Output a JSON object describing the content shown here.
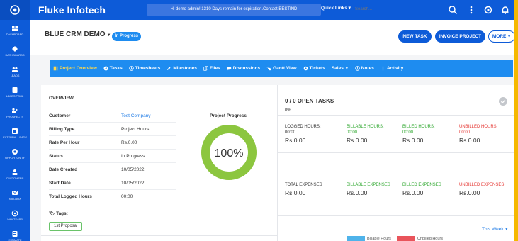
{
  "topbar": {
    "brand": "Fluke Infotech",
    "notice": "Hi demo admin! 1310 Days remain for expiration.Contact BESTIND",
    "quick_links": "Quick Links",
    "search_placeholder": "Search..."
  },
  "sidebar": {
    "items": [
      {
        "label": "DASHBOARD",
        "icon": "dashboard-icon"
      },
      {
        "label": "DASHBOARDS",
        "icon": "dashboards-icon"
      },
      {
        "label": "LEADS",
        "icon": "leads-icon"
      },
      {
        "label": "LEADS POOL",
        "icon": "leads-pool-icon"
      },
      {
        "label": "PROSPECTS",
        "icon": "prospects-icon"
      },
      {
        "label": "EXTERNAL LEADS",
        "icon": "external-leads-icon"
      },
      {
        "label": "OPPORTUNITY",
        "icon": "opportunity-icon"
      },
      {
        "label": "CUSTOMERS",
        "icon": "customers-icon"
      },
      {
        "label": "MAILBOX",
        "icon": "mailbox-icon"
      },
      {
        "label": "WHATSAPP",
        "icon": "whatsapp-icon"
      },
      {
        "label": "ESTIMATE",
        "icon": "estimate-icon"
      }
    ]
  },
  "project": {
    "title": "BLUE CRM DEMO",
    "status": "In Progress",
    "buttons": {
      "new_task": "NEW TASK",
      "invoice": "INVOICE PROJECT",
      "more": "MORE"
    }
  },
  "tabs": [
    {
      "label": "Project Overview",
      "icon": "bars-icon"
    },
    {
      "label": "Tasks",
      "icon": "check-circle-icon"
    },
    {
      "label": "Timesheets",
      "icon": "clock-icon"
    },
    {
      "label": "Milestones",
      "icon": "rocket-icon"
    },
    {
      "label": "Files",
      "icon": "files-icon"
    },
    {
      "label": "Discussions",
      "icon": "comments-icon"
    },
    {
      "label": "Gantt View",
      "icon": "gantt-icon"
    },
    {
      "label": "Tickets",
      "icon": "ticket-icon"
    },
    {
      "label": "Sales",
      "icon": ""
    },
    {
      "label": "Notes",
      "icon": "notes-icon"
    },
    {
      "label": "Activity",
      "icon": "activity-icon"
    }
  ],
  "overview": {
    "title": "OVERVIEW",
    "rows": [
      {
        "key": "Customer",
        "value": "Test Company"
      },
      {
        "key": "Billing Type",
        "value": "Project Hours"
      },
      {
        "key": "Rate Per Hour",
        "value": "Rs.0.00"
      },
      {
        "key": "Status",
        "value": "In Progress"
      },
      {
        "key": "Date Created",
        "value": "10/05/2022"
      },
      {
        "key": "Start Date",
        "value": "10/05/2022"
      },
      {
        "key": "Total Logged Hours",
        "value": "00:00"
      }
    ],
    "progress_title": "Project Progress",
    "progress_value": "100%",
    "progress_fraction": 1.0,
    "tags_label": "Tags:",
    "tag": "1st Proposal"
  },
  "tasks": {
    "title": "0 / 0 OPEN TASKS",
    "percent": "0%"
  },
  "hours": [
    {
      "label": "LOGGED HOURS:",
      "time": "00:00",
      "value": "Rs.0.00",
      "color": "#333333"
    },
    {
      "label": "BILLABLE HOURS:",
      "time": "00:00",
      "value": "Rs.0.00",
      "color": "#2aa52a"
    },
    {
      "label": "BILLED HOURS:",
      "time": "00:00",
      "value": "Rs.0.00",
      "color": "#2aa52a"
    },
    {
      "label": "UNBILLED HOURS:",
      "time": "00:00",
      "value": "Rs.0.00",
      "color": "#e53935"
    }
  ],
  "expenses": [
    {
      "label": "TOTAL EXPENSES",
      "value": "Rs.0.00",
      "color": "#333333"
    },
    {
      "label": "BILLABLE EXPENSES",
      "value": "Rs.0.00",
      "color": "#2aa52a"
    },
    {
      "label": "BILLED EXPENSES",
      "value": "Rs.0.00",
      "color": "#2aa52a"
    },
    {
      "label": "UNBILLED EXPENSES",
      "value": "Rs.0.00",
      "color": "#e53935"
    }
  ],
  "chart": {
    "period": "This Week",
    "legend": [
      {
        "label": "Billable Hours",
        "color": "#4fb3ea"
      },
      {
        "label": "Unbilled Hours",
        "color": "#e9545b"
      }
    ]
  },
  "colors": {
    "primary": "#0d5bd8",
    "tab_bar": "#1e8cf0",
    "progress": "#8cc63f",
    "active_tab": "#ffd84a",
    "page_border": "#f5b800"
  }
}
